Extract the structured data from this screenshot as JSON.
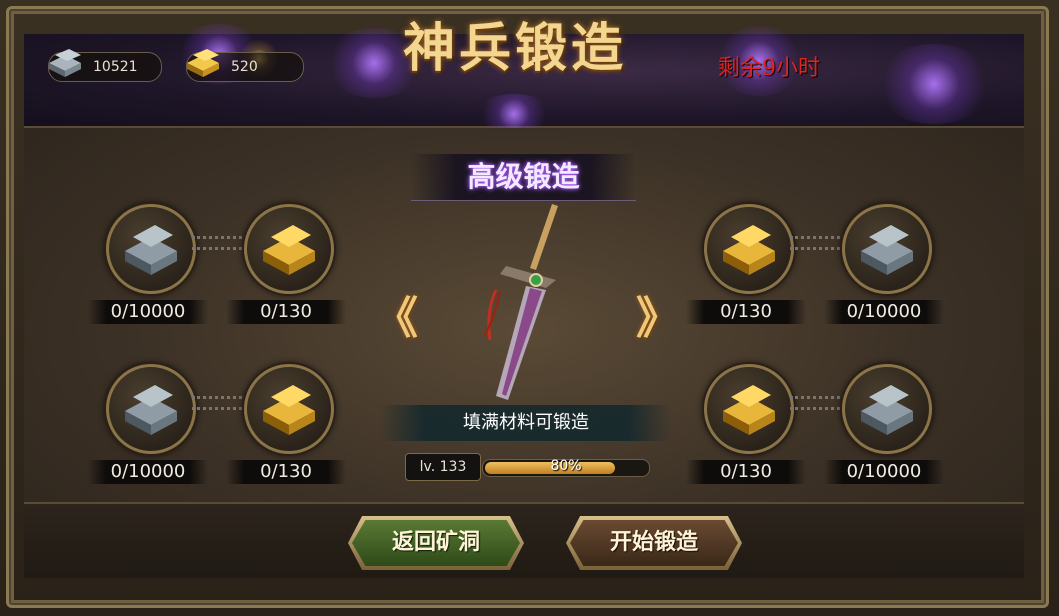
{
  "header": {
    "title": "神兵锻造",
    "time_left": "剩余9小时",
    "resources": [
      {
        "icon": "iron-ingot-icon",
        "value": "10521"
      },
      {
        "icon": "gold-ingot-icon",
        "value": "520"
      }
    ]
  },
  "forge": {
    "mode_tab": "高级锻造",
    "prev_arrow": "《",
    "next_arrow": "》",
    "hint": "填满材料可锻造",
    "level": "lv. 133",
    "progress_label": "80%",
    "progress": 0.8,
    "materials": [
      {
        "icon": "iron-ingot-icon",
        "count": "0/10000"
      },
      {
        "icon": "gold-ingot-icon",
        "count": "0/130"
      },
      {
        "icon": "iron-ingot-icon",
        "count": "0/10000"
      },
      {
        "icon": "gold-ingot-icon",
        "count": "0/130"
      },
      {
        "icon": "gold-ingot-icon",
        "count": "0/130"
      },
      {
        "icon": "iron-ingot-icon",
        "count": "0/10000"
      },
      {
        "icon": "gold-ingot-icon",
        "count": "0/130"
      },
      {
        "icon": "iron-ingot-icon",
        "count": "0/10000"
      }
    ]
  },
  "buttons": {
    "back": "返回矿洞",
    "start": "开始锻造"
  },
  "colors": {
    "title": "#f3d690",
    "time_left": "#e02424",
    "mode_glow": "#b469ff",
    "progress": "#f0c060"
  }
}
